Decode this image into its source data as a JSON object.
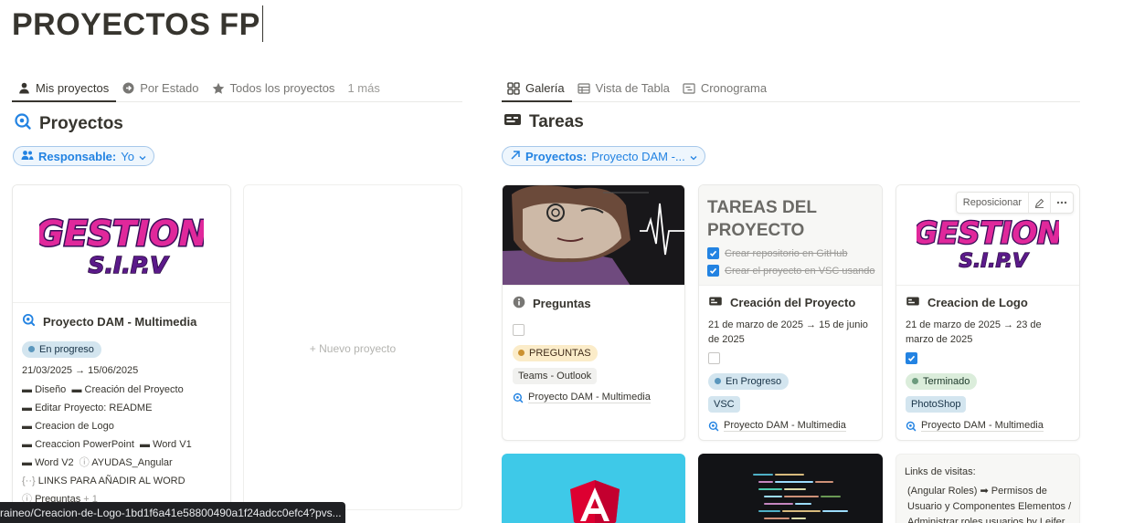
{
  "page": {
    "title": "PROYECTOS FP"
  },
  "left_tabs": [
    {
      "label": "Mis proyectos",
      "icon": "person-icon"
    },
    {
      "label": "Por Estado",
      "icon": "arrow-circle-icon"
    },
    {
      "label": "Todos los proyectos",
      "icon": "star-icon"
    },
    {
      "label": "1 más"
    }
  ],
  "right_tabs": [
    {
      "label": "Galería",
      "icon": "gallery-icon"
    },
    {
      "label": "Vista de Tabla",
      "icon": "table-icon"
    },
    {
      "label": "Cronograma",
      "icon": "timeline-icon"
    }
  ],
  "projects": {
    "title": "Proyectos",
    "filter": {
      "label": "Responsable:",
      "value": "Yo"
    },
    "card": {
      "logo_text": "GESTION S.I.P.V",
      "title": "Proyecto DAM - Multimedia",
      "status": "En progreso",
      "dates": "21/03/2025 → 15/06/2025",
      "tasks": [
        "Diseño",
        "Creación del Proyecto",
        "Editar Proyecto: README",
        "Creacion de Logo",
        "Creaccion PowerPoint",
        "Word V1",
        "Word V2",
        "AYUDAS_Angular",
        "LINKS PARA AÑADIR AL WORD",
        "Preguntas"
      ],
      "more_count": "+ 1"
    },
    "new_label": "+ Nuevo proyecto"
  },
  "tasks": {
    "title": "Tareas",
    "filter": {
      "label": "Proyectos:",
      "value": "Proyecto DAM -..."
    },
    "cards": [
      {
        "title": "Preguntas",
        "tag1": "PREGUNTAS",
        "tag2": "Teams - Outlook",
        "project": "Proyecto DAM - Multimedia"
      },
      {
        "cover_heading": "TAREAS DEL PROYECTO",
        "cover_item1": "Crear repositorio en GitHub",
        "cover_item2": "Crear el proyecto en VSC usando",
        "title": "Creación del Proyecto",
        "dates": "21 de marzo de 2025 → 15 de junio de 2025",
        "status": "En Progreso",
        "tag": "VSC",
        "project": "Proyecto DAM - Multimedia"
      },
      {
        "logo_text": "GESTION S.I.P.V",
        "hover_reposition": "Reposicionar",
        "title": "Creacion de Logo",
        "dates": "21 de marzo de 2025 → 23 de marzo de 2025",
        "status": "Terminado",
        "tag": "PhotoShop",
        "project": "Proyecto DAM - Multimedia"
      }
    ],
    "links_card": {
      "heading": "Links de visitas:",
      "text": "(Angular Roles) ➡ Permisos de Usuario y Componentes Elementos / Administrar roles usuarios by Leifer"
    }
  },
  "status_url": "raineo/Creacion-de-Logo-1bd1f6a41e58800490a1f24adcc0efc4?pvs...",
  "colors": {
    "accent": "#2383e2",
    "logo_pink": "#e0289b",
    "logo_purple": "#5b1a8a"
  }
}
